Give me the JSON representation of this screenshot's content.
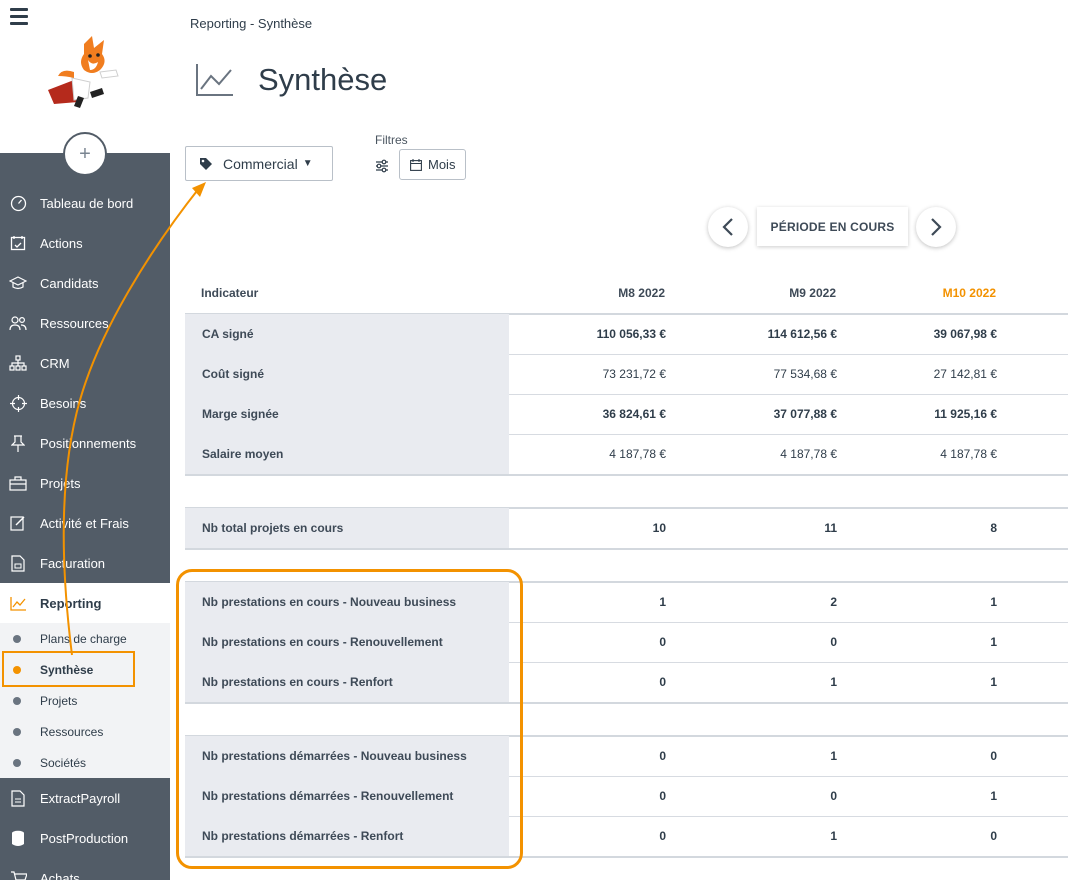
{
  "sidebar": {
    "items": [
      {
        "label": "Tableau de bord",
        "icon": "dashboard-icon"
      },
      {
        "label": "Actions",
        "icon": "calendar-check-icon"
      },
      {
        "label": "Candidats",
        "icon": "graduation-cap-icon"
      },
      {
        "label": "Ressources",
        "icon": "people-icon"
      },
      {
        "label": "CRM",
        "icon": "org-chart-icon"
      },
      {
        "label": "Besoins",
        "icon": "crosshair-icon"
      },
      {
        "label": "Positionnements",
        "icon": "pin-icon"
      },
      {
        "label": "Projets",
        "icon": "briefcase-icon"
      },
      {
        "label": "Activité et Frais",
        "icon": "edit-icon"
      },
      {
        "label": "Facturation",
        "icon": "invoice-icon"
      },
      {
        "label": "Reporting",
        "icon": "chart-line-icon"
      }
    ],
    "sub_items": [
      "Plans de charge",
      "Synthèse",
      "Projets",
      "Ressources",
      "Sociétés"
    ],
    "bottom_items": [
      {
        "label": "ExtractPayroll",
        "icon": "file-icon"
      },
      {
        "label": "PostProduction",
        "icon": "database-icon"
      },
      {
        "label": "Achats",
        "icon": "cart-icon"
      }
    ]
  },
  "header": {
    "breadcrumb": "Reporting - Synthèse",
    "title": "Synthèse"
  },
  "toolbar": {
    "dropdown_label": "Commercial",
    "filters_label": "Filtres",
    "mois_label": "Mois",
    "periode_label": "PÉRIODE EN COURS"
  },
  "colors": {
    "accent": "#f39200",
    "sidebar": "#525c67",
    "row_label_bg": "#e9ebf0"
  },
  "table": {
    "header": {
      "indicator": "Indicateur",
      "m8": "M8 2022",
      "m9": "M9 2022",
      "m10": "M10 2022"
    },
    "rows": [
      {
        "label": "CA signé",
        "m8": "110 056,33 €",
        "m9": "114 612,56 €",
        "m10": "39 067,98 €"
      },
      {
        "label": "Coût signé",
        "m8": "73 231,72 €",
        "m9": "77 534,68 €",
        "m10": "27 142,81 €"
      },
      {
        "label": "Marge signée",
        "m8": "36 824,61 €",
        "m9": "37 077,88 €",
        "m10": "11 925,16 €"
      },
      {
        "label": "Salaire moyen",
        "m8": "4 187,78 €",
        "m9": "4 187,78 €",
        "m10": "4 187,78 €"
      },
      {
        "label": "Nb total projets en cours",
        "m8": "10",
        "m9": "11",
        "m10": "8"
      },
      {
        "label": "Nb prestations en cours - Nouveau business",
        "m8": "1",
        "m9": "2",
        "m10": "1"
      },
      {
        "label": "Nb prestations en cours - Renouvellement",
        "m8": "0",
        "m9": "0",
        "m10": "1"
      },
      {
        "label": "Nb prestations en cours - Renfort",
        "m8": "0",
        "m9": "1",
        "m10": "1"
      },
      {
        "label": "Nb prestations démarrées - Nouveau business",
        "m8": "0",
        "m9": "1",
        "m10": "0"
      },
      {
        "label": "Nb prestations démarrées - Renouvellement",
        "m8": "0",
        "m9": "0",
        "m10": "1"
      },
      {
        "label": "Nb prestations démarrées - Renfort",
        "m8": "0",
        "m9": "1",
        "m10": "0"
      }
    ]
  }
}
